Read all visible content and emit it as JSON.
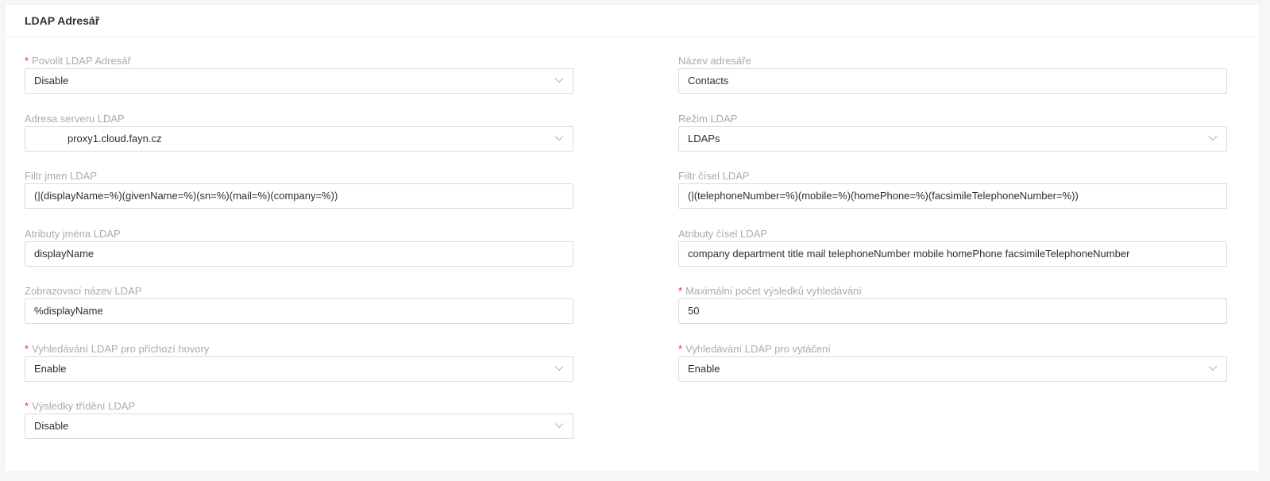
{
  "panel": {
    "title": "LDAP Adresář"
  },
  "fields": {
    "enable_ldap": {
      "label": "Povolit LDAP Adresář",
      "required": true,
      "type": "select",
      "value": "Disable"
    },
    "directory_name": {
      "label": "Název adresáře",
      "required": false,
      "type": "input",
      "value": "Contacts"
    },
    "server_address": {
      "label": "Adresa serveru LDAP",
      "required": false,
      "type": "select",
      "value": "proxy1.cloud.fayn.cz"
    },
    "ldap_mode": {
      "label": "Režim LDAP",
      "required": false,
      "type": "select",
      "value": "LDAPs"
    },
    "name_filter": {
      "label": "Filtr jmen LDAP",
      "required": false,
      "type": "input",
      "value": "(|(displayName=%)(givenName=%)(sn=%)(mail=%)(company=%))"
    },
    "number_filter": {
      "label": "Filtr čísel LDAP",
      "required": false,
      "type": "input",
      "value": "(|(telephoneNumber=%)(mobile=%)(homePhone=%)(facsimileTelephoneNumber=%))"
    },
    "name_attributes": {
      "label": "Atributy jména LDAP",
      "required": false,
      "type": "input",
      "value": "displayName"
    },
    "number_attributes": {
      "label": "Atributy čísel LDAP",
      "required": false,
      "type": "input",
      "value": "company department title mail telephoneNumber mobile homePhone facsimileTelephoneNumber"
    },
    "display_name": {
      "label": "Zobrazovací název LDAP",
      "required": false,
      "type": "input",
      "value": "%displayName"
    },
    "max_results": {
      "label": "Maximální počet výsledků vyhledávání",
      "required": true,
      "type": "input",
      "value": "50"
    },
    "incoming_lookup": {
      "label": "Vyhledávání LDAP pro příchozí hovory",
      "required": true,
      "type": "select",
      "value": "Enable"
    },
    "dialing_lookup": {
      "label": "Vyhledávání LDAP pro vytáčení",
      "required": true,
      "type": "select",
      "value": "Enable"
    },
    "sort_results": {
      "label": "Výsledky třídění LDAP",
      "required": true,
      "type": "select",
      "value": "Disable"
    }
  },
  "icons": {
    "select_arrow": "chevron-down-icon"
  },
  "colors": {
    "required_marker": "#e02e2e",
    "label_text": "#a7abb3",
    "value_text": "#2b2e33",
    "border": "#d9dce1"
  }
}
